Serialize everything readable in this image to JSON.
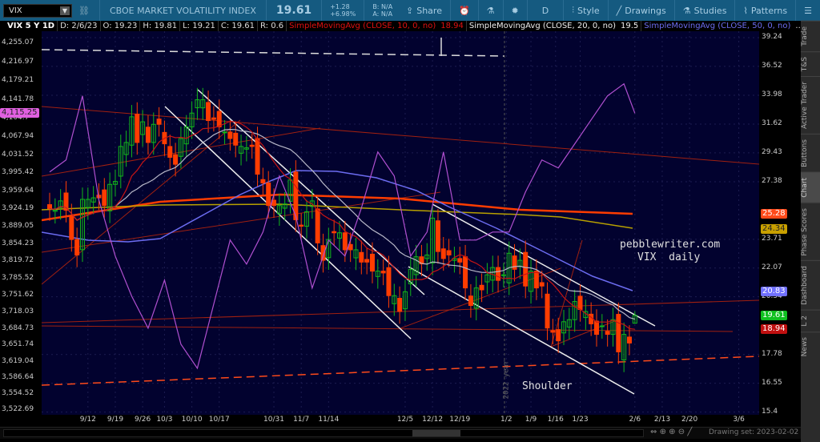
{
  "header": {
    "symbol": "VIX",
    "description": "CBOE MARKET VOLATILITY INDEX",
    "last": "19.61",
    "change": "+1.28",
    "change_pct": "+6.98%",
    "bid": "B: N/A",
    "ask": "A: N/A",
    "buttons": {
      "share": "Share",
      "period": "D",
      "style": "Style",
      "drawings": "Drawings",
      "studies": "Studies",
      "patterns": "Patterns"
    }
  },
  "infobar": {
    "title": "VIX 5 Y 1D",
    "date": "D: 2/6/23",
    "open": "O: 19.23",
    "high": "H: 19.81",
    "low": "L: 19.21",
    "close": "C: 19.61",
    "range": "R: 0.6",
    "sma10_label": "SimpleMovingAvg (CLOSE, 10, 0, no)",
    "sma10_value": "18.94",
    "sma20_label": "SimpleMovingAvg (CLOSE, 20, 0, no)",
    "sma20_value": "19.5",
    "sma50_label": "SimpleMovingAvg (CLOSE, 50, 0, no)",
    "more": "..."
  },
  "tabs": [
    "Trade",
    "T&S",
    "Active Trader",
    "Buttons",
    "Chart",
    "Phase Scores",
    "Dashboard",
    "L 2",
    "News"
  ],
  "active_tab": "Chart",
  "annotations": {
    "site": "pebblewriter.com",
    "subtitle": "VIX  daily",
    "shoulder": "Shoulder",
    "year_marker": "2022 year"
  },
  "footer": {
    "drawing_set": "Drawing set: 2023-02-02"
  },
  "colors": {
    "up": "#12b81a",
    "down": "#ff3c00",
    "sma10": "#c81414",
    "sma20": "#b8b8c8",
    "sma50": "#6c6cf0",
    "spx": "#b050d0",
    "bg": "#02022f"
  },
  "chart_data": {
    "type": "candlestick",
    "title": "VIX 5 Y 1D",
    "right_axis": {
      "scale": "log",
      "range": [
        15.4,
        39.24
      ],
      "ticks": [
        "39.24",
        "36.52",
        "33.98",
        "31.62",
        "29.43",
        "27.38",
        "23.71",
        "22.07",
        "20.54",
        "17.78",
        "16.55",
        "15.4"
      ]
    },
    "left_axis": {
      "range": [
        3522.69,
        4255.07
      ],
      "ticks": [
        "4,255.07",
        "4,216.97",
        "4,179.21",
        "4,141.78",
        "4,104.7",
        "4,067.94",
        "4,031.52",
        "3,995.42",
        "3,959.64",
        "3,924.19",
        "3,889.05",
        "3,854.23",
        "3,819.72",
        "3,785.52",
        "3,751.62",
        "3,718.03",
        "3,684.73",
        "3,651.74",
        "3,619.04",
        "3,586.64",
        "3,554.52",
        "3,522.69"
      ]
    },
    "x_labels": [
      {
        "t": "9/12",
        "i": 7
      },
      {
        "t": "9/19",
        "i": 12
      },
      {
        "t": "9/26",
        "i": 17
      },
      {
        "t": "10/3",
        "i": 21
      },
      {
        "t": "10/10",
        "i": 26
      },
      {
        "t": "10/17",
        "i": 31
      },
      {
        "t": "10/31",
        "i": 41
      },
      {
        "t": "11/7",
        "i": 46
      },
      {
        "t": "11/14",
        "i": 51
      },
      {
        "t": "12/5",
        "i": 65
      },
      {
        "t": "12/12",
        "i": 70
      },
      {
        "t": "12/19",
        "i": 75
      },
      {
        "t": "1/2",
        "i": 83.5
      },
      {
        "t": "1/9",
        "i": 88
      },
      {
        "t": "1/16",
        "i": 92.5
      },
      {
        "t": "1/23",
        "i": 97
      },
      {
        "t": "2/6",
        "i": 107
      },
      {
        "t": "2/13",
        "i": 112
      },
      {
        "t": "2/20",
        "i": 117
      },
      {
        "t": "3/6",
        "i": 126
      }
    ],
    "vix_close": [
      25.6,
      25.5,
      26.1,
      25.5,
      23.7,
      22.8,
      26.2,
      26.2,
      26.3,
      26.3,
      25.8,
      27.2,
      27.4,
      29.9,
      30.2,
      32.2,
      30.2,
      31.8,
      30.2,
      31.6,
      31.6,
      30.1,
      29.1,
      28.6,
      30.5,
      31.4,
      32.5,
      33.6,
      33.6,
      31.9,
      32.0,
      31.4,
      31.0,
      30.5,
      30.0,
      29.9,
      29.8,
      29.9,
      27.9,
      27.3,
      25.8,
      25.8,
      25.8,
      25.9,
      27.5,
      24.9,
      24.5,
      25.4,
      26.1,
      23.5,
      22.5,
      23.7,
      24.1,
      24.1,
      23.1,
      23.1,
      23.1,
      22.4,
      22.4,
      21.9,
      21.9,
      21.8,
      20.6,
      20.6,
      19.8,
      20.8,
      22.0,
      22.7,
      22.3,
      22.8,
      25.0,
      23.0,
      22.6,
      22.8,
      22.6,
      22.4,
      21.0,
      20.1,
      21.0,
      20.9,
      21.7,
      22.1,
      21.4,
      21.7,
      22.9,
      22.0,
      22.5,
      21.1,
      21.9,
      21.0,
      21.1,
      19.0,
      18.8,
      18.4,
      19.3,
      19.4,
      20.3,
      19.9,
      19.8,
      19.2,
      18.7,
      19.1,
      18.7,
      19.4,
      17.9,
      18.7,
      18.3,
      19.61
    ],
    "last_bar": {
      "date": "2/6/23",
      "open": 19.23,
      "high": 19.81,
      "low": 19.21,
      "close": 19.61
    },
    "spx_overlay": {
      "step": 3,
      "values": [
        3998,
        4022,
        4150,
        3942,
        3830,
        3750,
        3686,
        3782,
        3654,
        3606,
        3734,
        3862,
        3814,
        3878,
        3990,
        3910,
        3766,
        3862,
        3830,
        3926,
        4038,
        3990,
        3830,
        3878,
        4038,
        3862,
        3862,
        3878,
        3878,
        3958,
        4022,
        4006,
        4054,
        4102,
        4150,
        4174
      ],
      "last": 4115.25
    },
    "price_tags": [
      {
        "label": "25.28",
        "color": "#ff4a1a",
        "fg": "#fff"
      },
      {
        "label": "24.34",
        "color": "#c8a000",
        "fg": "#222"
      },
      {
        "label": "20.83",
        "color": "#7070ff",
        "fg": "#fff"
      },
      {
        "label": "19.61",
        "color": "#10c020",
        "fg": "#fff"
      },
      {
        "label": "18.94",
        "color": "#c01010",
        "fg": "#fff"
      }
    ],
    "left_tag": {
      "label": "4,115.25",
      "color": "#e060e0"
    }
  }
}
